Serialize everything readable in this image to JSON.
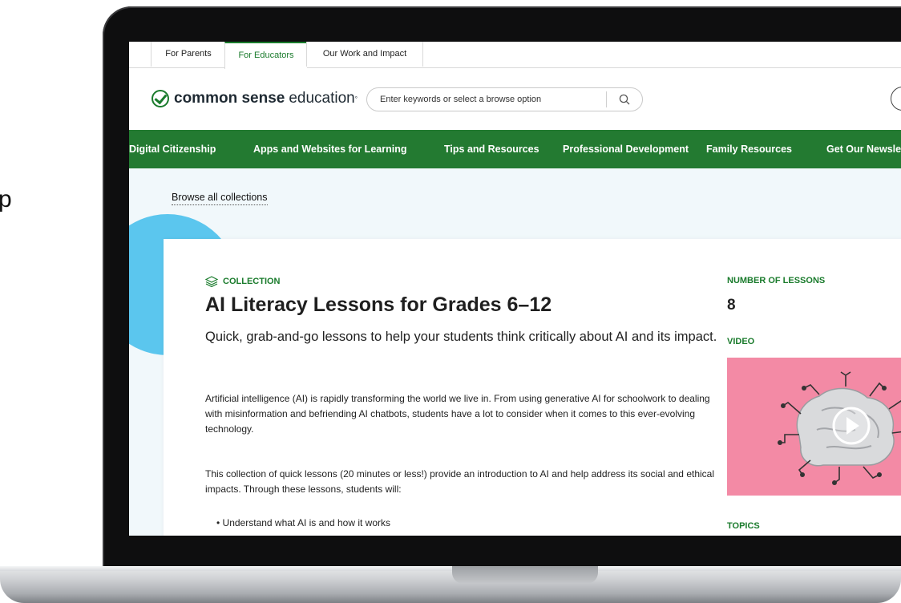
{
  "partial_text": "p",
  "top_tabs": [
    "For Parents",
    "For Educators",
    "Our Work and Impact"
  ],
  "logo": {
    "bold": "common sense",
    "light": "education",
    "sup": "°"
  },
  "search": {
    "placeholder": "Enter keywords or select a browse option",
    "icon": "search-icon"
  },
  "nav": [
    "Digital Citizenship",
    "Apps and Websites for Learning",
    "Tips and Resources",
    "Professional Development",
    "Family Resources",
    "Get Our Newsle"
  ],
  "browse_link": "Browse all collections",
  "collection": {
    "label": "COLLECTION",
    "title": "AI Literacy Lessons for Grades 6–12",
    "subtitle": "Quick, grab-and-go lessons to help your students think critically about AI and its impact.",
    "para1": "Artificial intelligence (AI) is rapidly transforming the world we live in. From using generative AI for schoolwork to dealing with misinformation and befriending AI chatbots, students have a lot to consider when it comes to this ever-evolving technology.",
    "para2": "This collection of quick lessons (20 minutes or less!) provide an introduction to AI and help address its social and ethical impacts. Through these lessons, students will:",
    "bullet1": "Understand what AI is and how it works"
  },
  "sidebar": {
    "lessons_label": "NUMBER OF LESSONS",
    "lessons_value": "8",
    "video_label": "VIDEO",
    "topics_label": "TOPICS"
  },
  "colors": {
    "brand_green": "#237a31",
    "accent_blue": "#5bc6ee",
    "video_pink": "#f38aa5"
  }
}
